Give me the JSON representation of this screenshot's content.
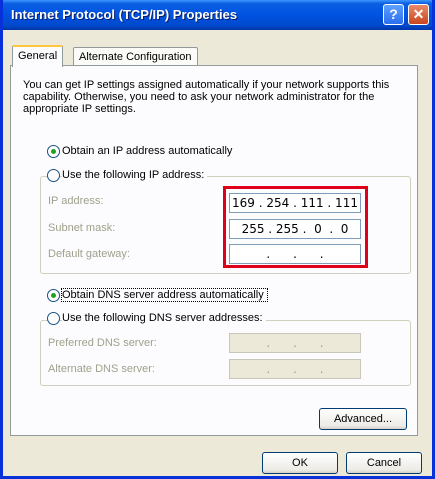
{
  "window": {
    "title": "Internet Protocol (TCP/IP) Properties",
    "help_glyph": "?",
    "close_glyph": "✕"
  },
  "tabs": [
    {
      "label": "General",
      "active": true
    },
    {
      "label": "Alternate Configuration",
      "active": false
    }
  ],
  "description": "You can get IP settings assigned automatically if your network supports this capability. Otherwise, you need to ask your network administrator for the appropriate IP settings.",
  "ip_section": {
    "auto_label": "Obtain an IP address automatically",
    "auto_selected": true,
    "manual_label": "Use the following IP address:",
    "manual_selected": false,
    "fields": [
      {
        "label": "IP address:",
        "value": "169 . 254 . 111 . 111"
      },
      {
        "label": "Subnet mask:",
        "value": "255 . 255 .  0  .  0"
      },
      {
        "label": "Default gateway:",
        "value": ".      .      ."
      }
    ]
  },
  "dns_section": {
    "auto_label": "Obtain DNS server address automatically",
    "auto_selected": true,
    "manual_label": "Use the following DNS server addresses:",
    "manual_selected": false,
    "fields": [
      {
        "label": "Preferred DNS server:",
        "value": ".      .      ."
      },
      {
        "label": "Alternate DNS server:",
        "value": ".      .      ."
      }
    ]
  },
  "buttons": {
    "advanced": "Advanced...",
    "ok": "OK",
    "cancel": "Cancel"
  },
  "colors": {
    "titlebar": "#0054e3",
    "highlight_box": "#e0001b",
    "radio_dot": "#21a121"
  }
}
